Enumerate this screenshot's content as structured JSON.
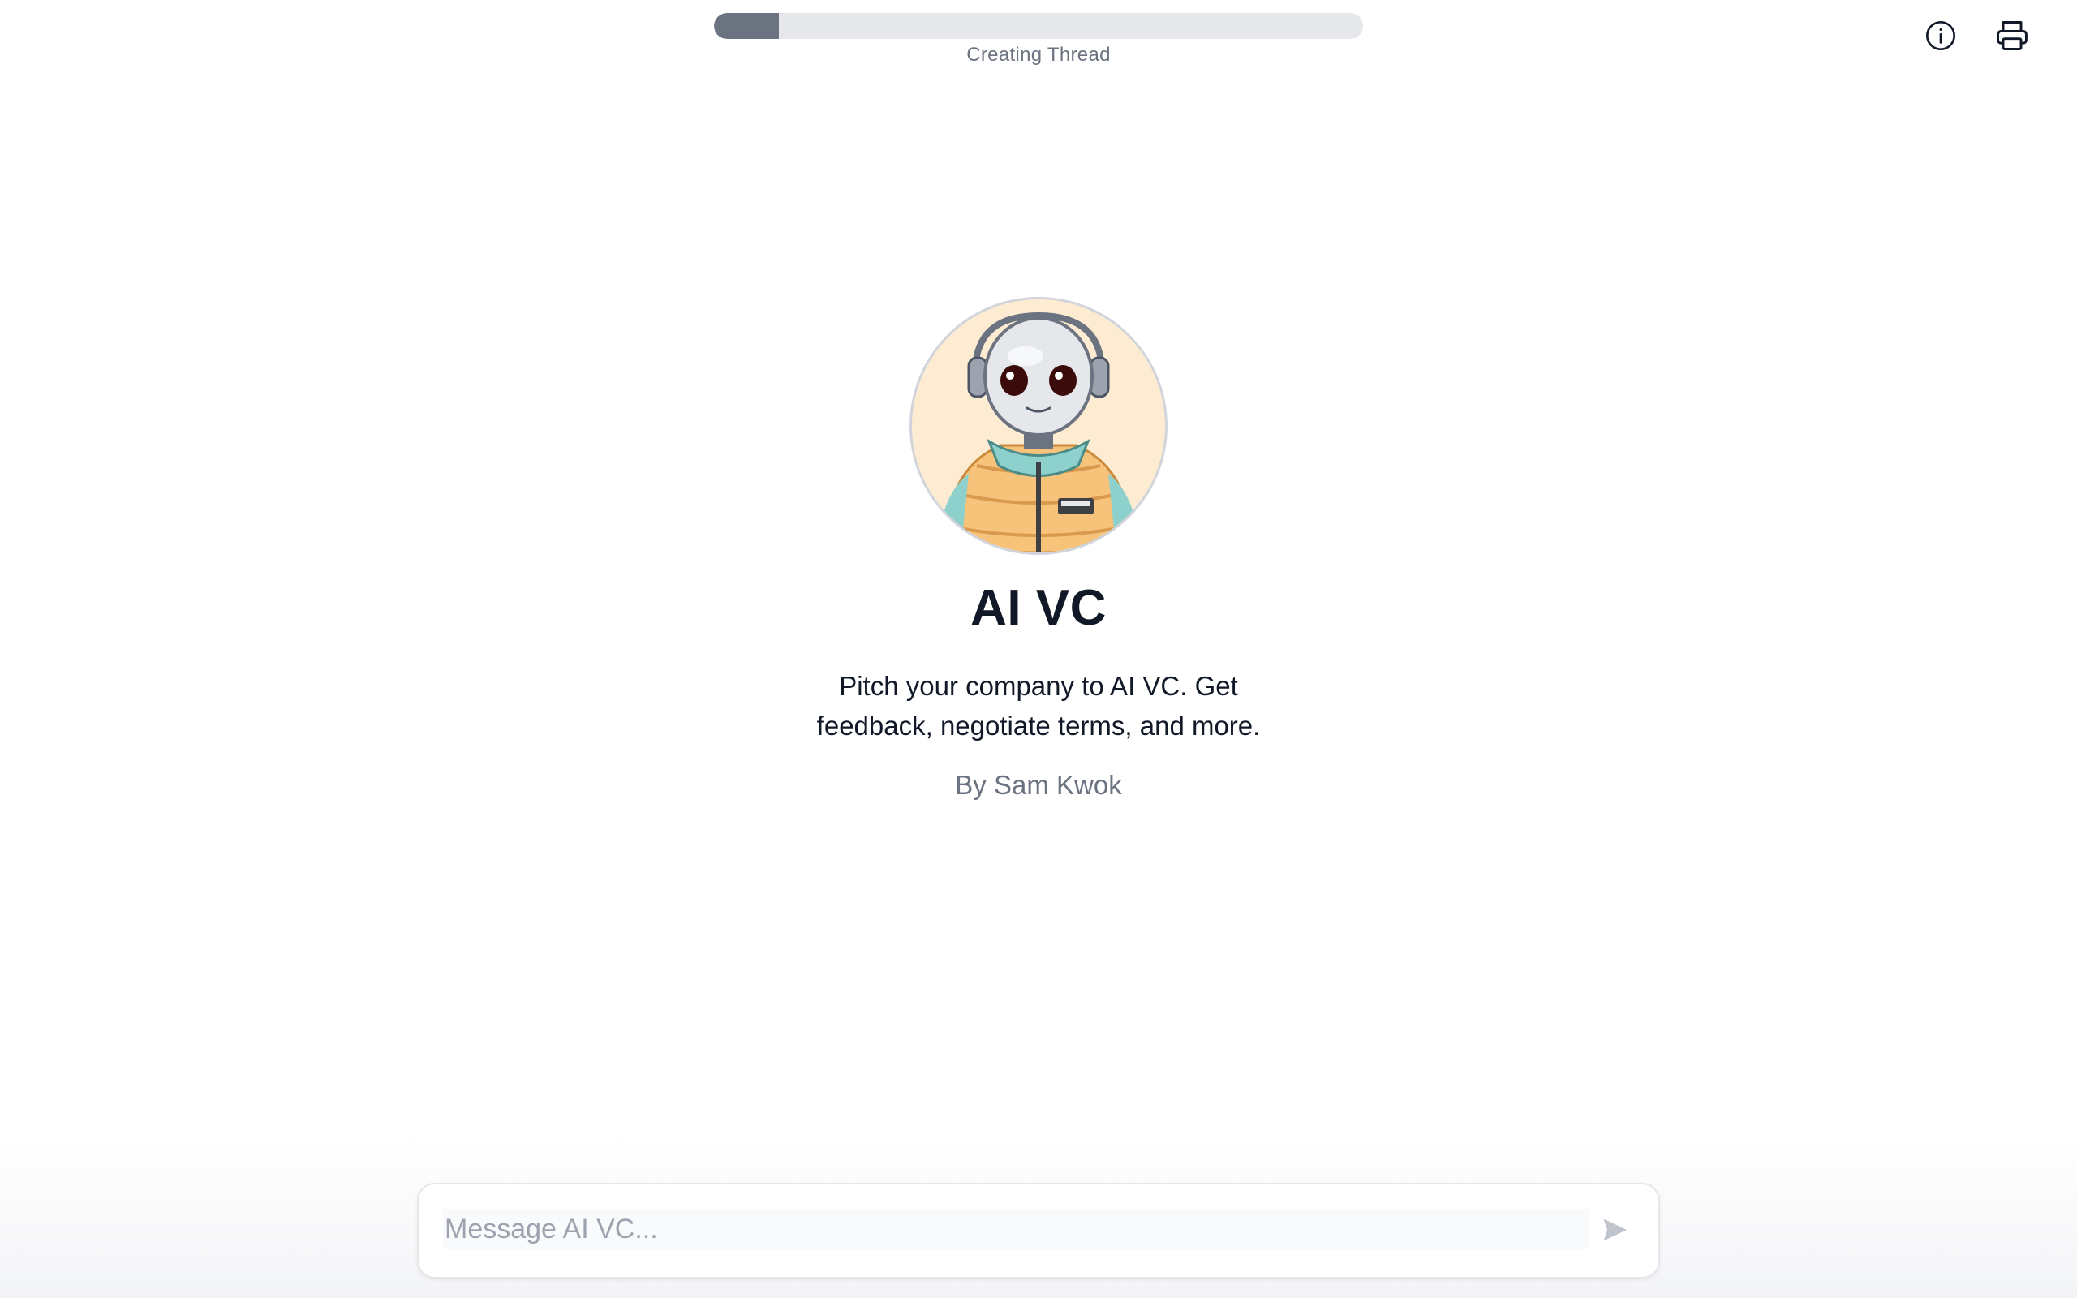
{
  "progress": {
    "label": "Creating Thread",
    "fraction": 0.1
  },
  "header": {
    "icons": [
      "info-icon",
      "printer-icon"
    ]
  },
  "hero": {
    "title": "AI VC",
    "description": "Pitch your company to AI VC. Get feedback, negotiate terms, and more.",
    "author": "By Sam Kwok"
  },
  "composer": {
    "placeholder": "Message AI VC...",
    "value": "",
    "send_icon": "send-icon"
  },
  "colors": {
    "progress_fill": "#6b7280",
    "progress_track": "#e5e7eb",
    "avatar_background": "#fdecd2",
    "title_text": "#111827",
    "muted_text": "#6b7280"
  }
}
